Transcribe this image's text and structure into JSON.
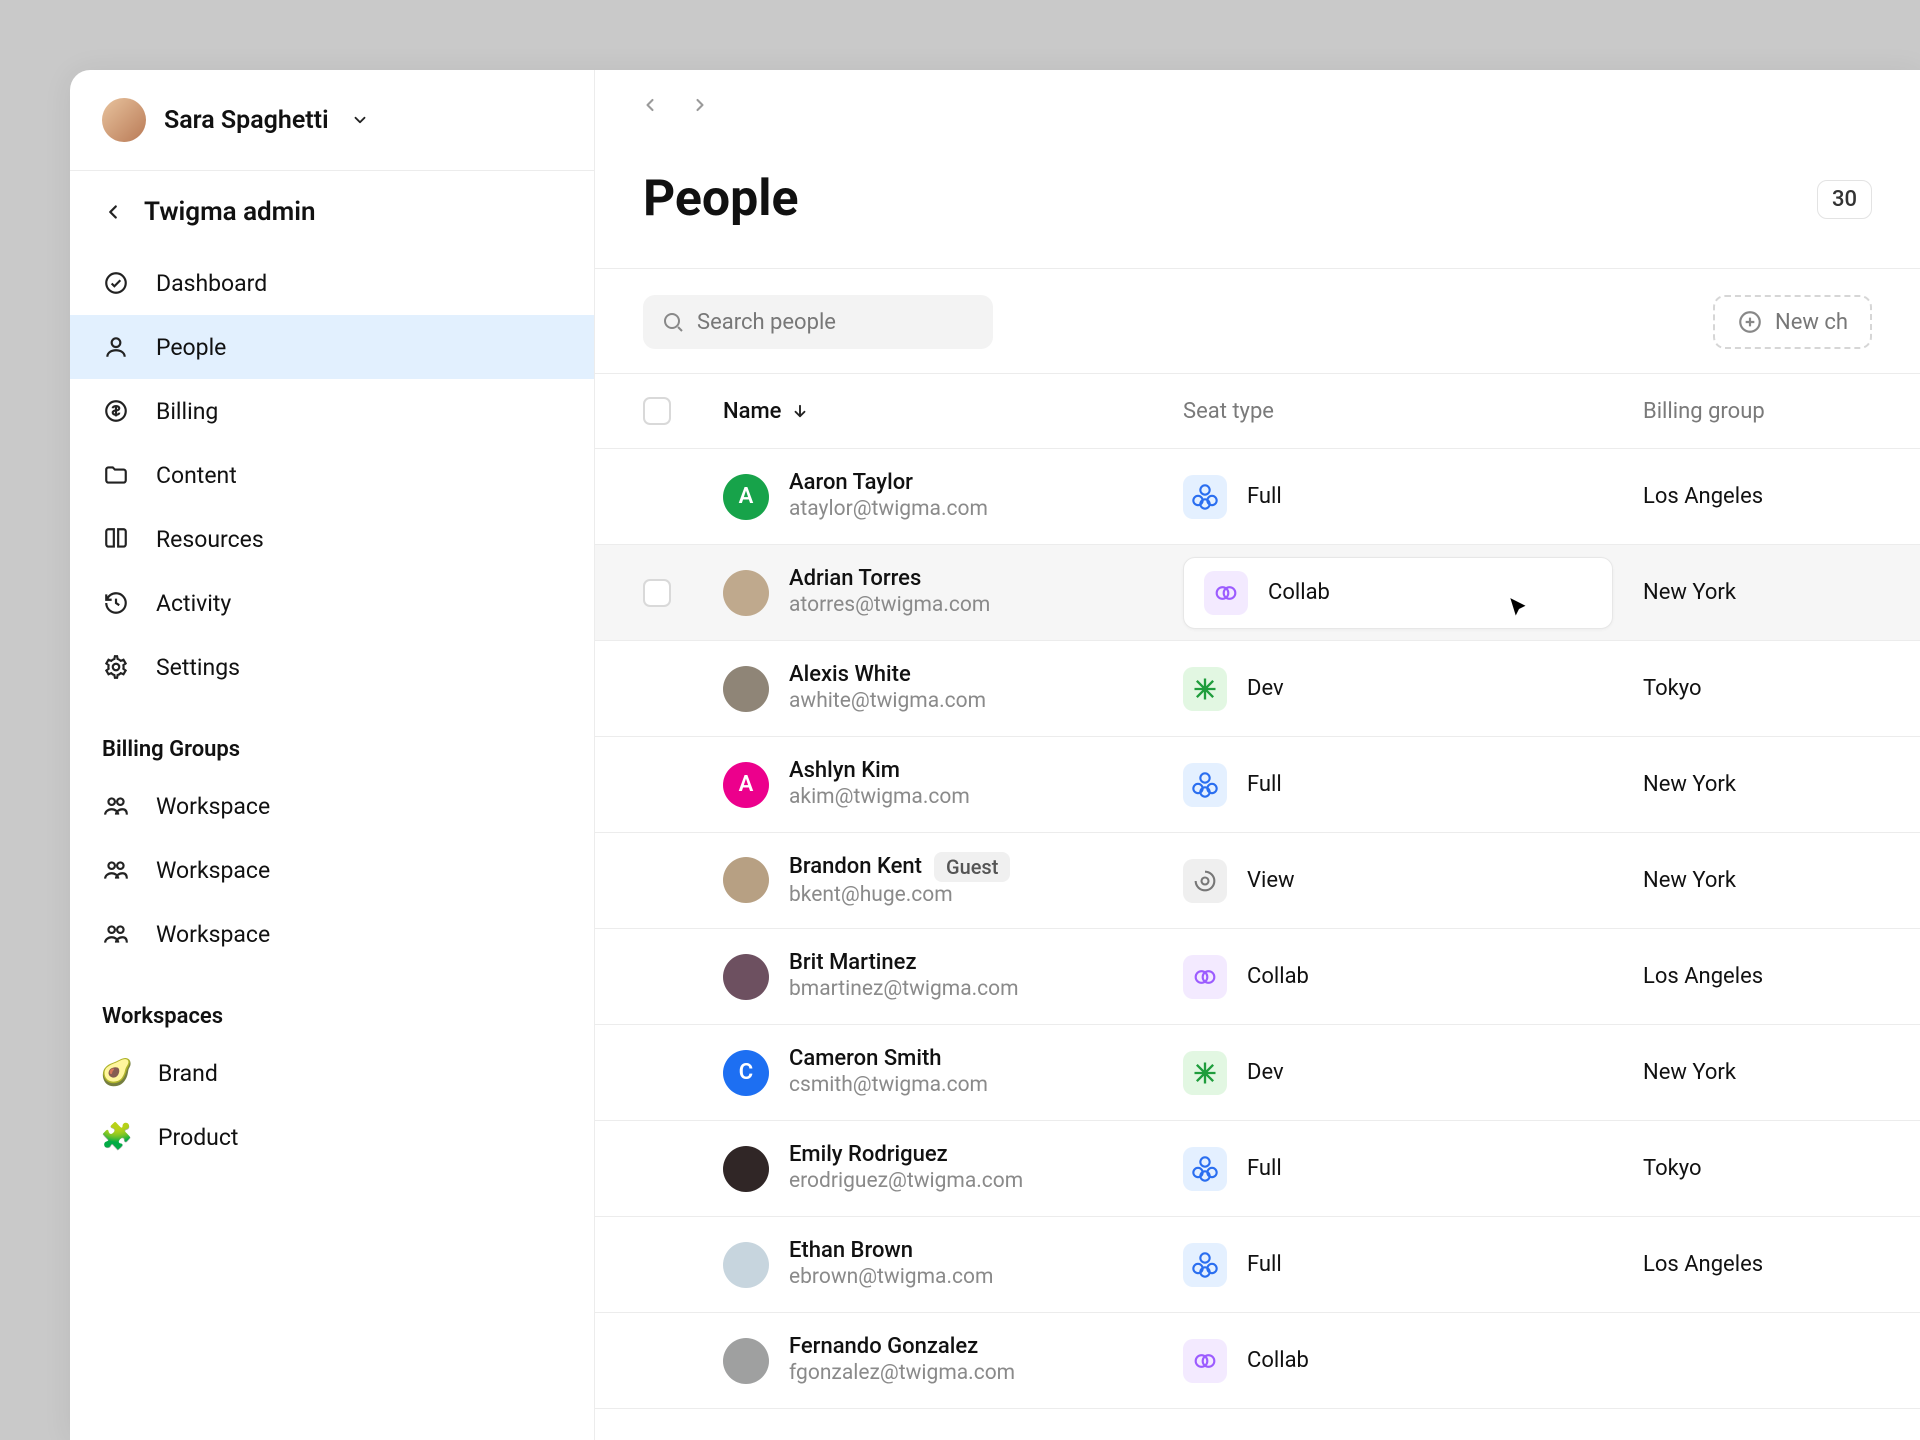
{
  "user": {
    "name": "Sara Spaghetti"
  },
  "section_title": "Twigma admin",
  "nav": [
    {
      "key": "dashboard",
      "label": "Dashboard"
    },
    {
      "key": "people",
      "label": "People"
    },
    {
      "key": "billing",
      "label": "Billing"
    },
    {
      "key": "content",
      "label": "Content"
    },
    {
      "key": "resources",
      "label": "Resources"
    },
    {
      "key": "activity",
      "label": "Activity"
    },
    {
      "key": "settings",
      "label": "Settings"
    }
  ],
  "billing_groups_header": "Billing Groups",
  "billing_groups": [
    {
      "label": "Workspace"
    },
    {
      "label": "Workspace"
    },
    {
      "label": "Workspace"
    }
  ],
  "workspaces_header": "Workspaces",
  "workspaces": [
    {
      "icon": "🥑",
      "label": "Brand"
    },
    {
      "icon": "🧩",
      "label": "Product"
    }
  ],
  "page": {
    "title": "People",
    "count": "30",
    "search_placeholder": "Search people",
    "new_button": "New ch"
  },
  "columns": {
    "name": "Name",
    "seat": "Seat type",
    "billing_group": "Billing group"
  },
  "rows": [
    {
      "name": "Aaron Taylor",
      "email": "ataylor@twigma.com",
      "seat": "Full",
      "seat_type": "full",
      "bg": "Los Angeles",
      "avatar": {
        "text": "A",
        "bg": "#17a34a"
      }
    },
    {
      "name": "Adrian Torres",
      "email": "atorres@twigma.com",
      "seat": "Collab",
      "seat_type": "collab",
      "bg": "New York",
      "avatar": {
        "bg": "#bfa98d"
      },
      "hover": true,
      "dropdown": true
    },
    {
      "name": "Alexis White",
      "email": "awhite@twigma.com",
      "seat": "Dev",
      "seat_type": "dev",
      "bg": "Tokyo",
      "avatar": {
        "bg": "#8f8577"
      }
    },
    {
      "name": "Ashlyn Kim",
      "email": "akim@twigma.com",
      "seat": "Full",
      "seat_type": "full",
      "bg": "New York",
      "avatar": {
        "text": "A",
        "bg": "#ec008c"
      }
    },
    {
      "name": "Brandon Kent",
      "email": "bkent@huge.com",
      "seat": "View",
      "seat_type": "view",
      "bg": "New York",
      "avatar": {
        "bg": "#b7a083"
      },
      "badge": "Guest"
    },
    {
      "name": "Brit Martinez",
      "email": "bmartinez@twigma.com",
      "seat": "Collab",
      "seat_type": "collab",
      "bg": "Los Angeles",
      "avatar": {
        "bg": "#6d5060"
      }
    },
    {
      "name": "Cameron Smith",
      "email": "csmith@twigma.com",
      "seat": "Dev",
      "seat_type": "dev",
      "bg": "New York",
      "avatar": {
        "text": "C",
        "bg": "#1d6ff2"
      }
    },
    {
      "name": "Emily Rodriguez",
      "email": "erodriguez@twigma.com",
      "seat": "Full",
      "seat_type": "full",
      "bg": "Tokyo",
      "avatar": {
        "bg": "#302626"
      }
    },
    {
      "name": "Ethan Brown",
      "email": "ebrown@twigma.com",
      "seat": "Full",
      "seat_type": "full",
      "bg": "Los Angeles",
      "avatar": {
        "bg": "#c7d5de"
      }
    },
    {
      "name": "Fernando Gonzalez",
      "email": "fgonzalez@twigma.com",
      "seat": "Collab",
      "seat_type": "collab",
      "bg": "",
      "avatar": {
        "bg": "#9fa0a0"
      }
    }
  ]
}
